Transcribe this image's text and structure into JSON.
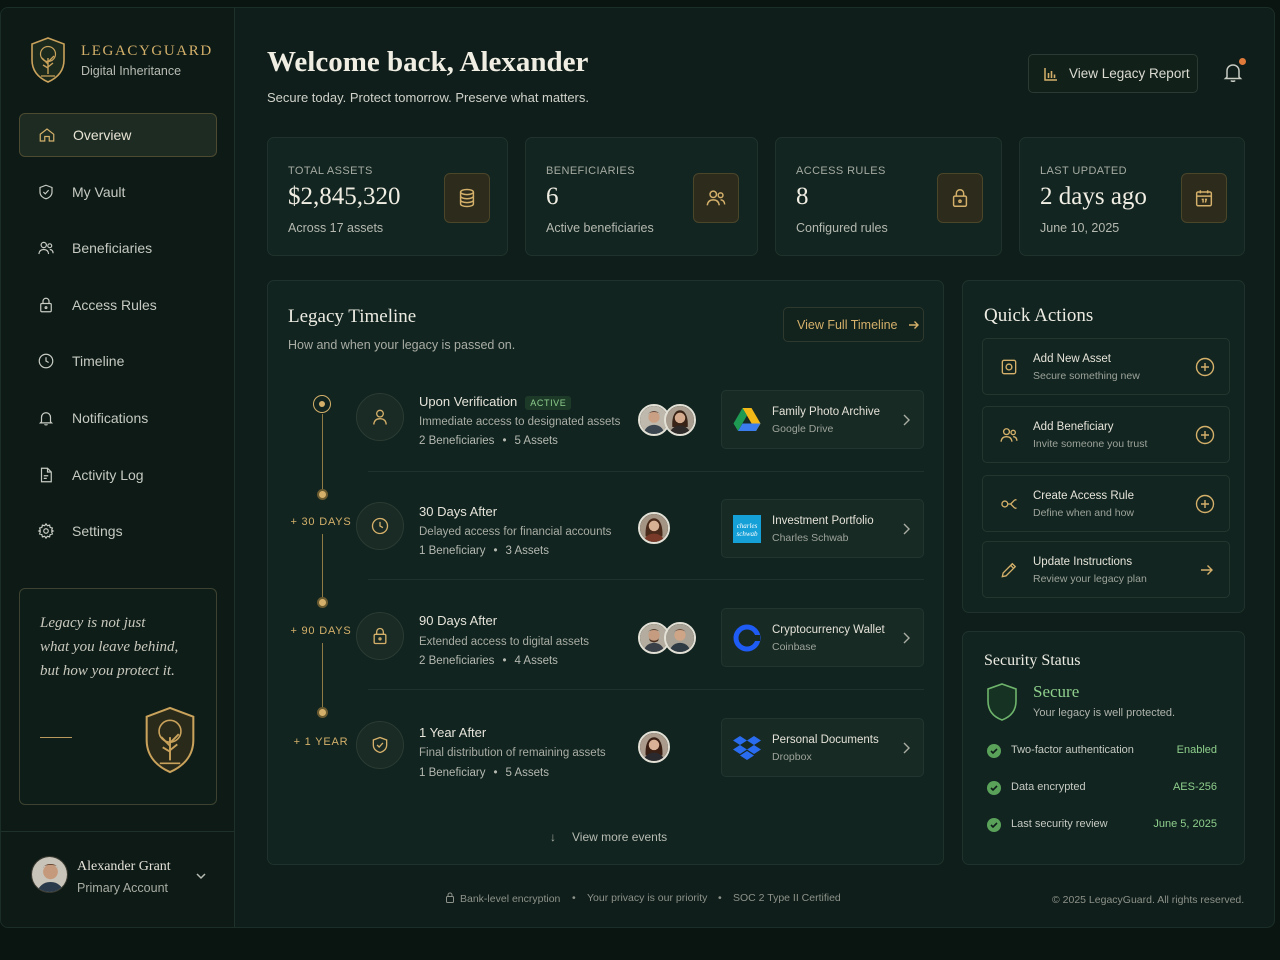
{
  "brand": {
    "name": "LEGACYGUARD",
    "tagline": "Digital Inheritance"
  },
  "nav": [
    {
      "label": "Overview",
      "icon": "home-icon",
      "active": true
    },
    {
      "label": "My Vault",
      "icon": "shield-icon"
    },
    {
      "label": "Beneficiaries",
      "icon": "users-icon"
    },
    {
      "label": "Access Rules",
      "icon": "lock-icon"
    },
    {
      "label": "Timeline",
      "icon": "clock-icon"
    },
    {
      "label": "Notifications",
      "icon": "bell-icon"
    },
    {
      "label": "Activity Log",
      "icon": "document-icon"
    },
    {
      "label": "Settings",
      "icon": "gear-icon"
    }
  ],
  "quote": {
    "line1": "Legacy is not just",
    "line2": "what you leave behind,",
    "line3": "but how you protect it."
  },
  "user": {
    "name": "Alexander Grant",
    "role": "Primary Account"
  },
  "header": {
    "welcome": "Welcome back, Alexander",
    "tagline": "Secure today. Protect tomorrow. Preserve what matters.",
    "report_button": "View Legacy Report"
  },
  "stats": [
    {
      "label": "TOTAL ASSETS",
      "value": "$2,845,320",
      "sub": "Across 17 assets",
      "icon": "database-icon"
    },
    {
      "label": "BENEFICIARIES",
      "value": "6",
      "sub": "Active beneficiaries",
      "icon": "users-icon"
    },
    {
      "label": "ACCESS RULES",
      "value": "8",
      "sub": "Configured rules",
      "icon": "lock-icon"
    },
    {
      "label": "LAST UPDATED",
      "value": "2 days ago",
      "sub": "June 10, 2025",
      "icon": "calendar-icon"
    }
  ],
  "timeline": {
    "title": "Legacy Timeline",
    "subtitle": "How and when your legacy is passed on.",
    "full_button": "View Full Timeline",
    "more": "View more events",
    "gaps": [
      "+ 30 DAYS",
      "+ 90 DAYS",
      "+ 1 YEAR"
    ],
    "events": [
      {
        "title": "Upon Verification",
        "badge": "ACTIVE",
        "desc": "Immediate access to designated assets",
        "beneficiaries": "2 Beneficiaries",
        "assets": "5 Assets",
        "asset_name": "Family Photo Archive",
        "asset_source": "Google Drive"
      },
      {
        "title": "30 Days After",
        "desc": "Delayed access for financial accounts",
        "beneficiaries": "1 Beneficiary",
        "assets": "3 Assets",
        "asset_name": "Investment Portfolio",
        "asset_source": "Charles Schwab"
      },
      {
        "title": "90 Days After",
        "desc": "Extended access to digital assets",
        "beneficiaries": "2 Beneficiaries",
        "assets": "4 Assets",
        "asset_name": "Cryptocurrency Wallet",
        "asset_source": "Coinbase"
      },
      {
        "title": "1 Year After",
        "desc": "Final distribution of remaining assets",
        "beneficiaries": "1 Beneficiary",
        "assets": "5 Assets",
        "asset_name": "Personal Documents",
        "asset_source": "Dropbox"
      }
    ]
  },
  "quick_actions": {
    "title": "Quick Actions",
    "items": [
      {
        "title": "Add New Asset",
        "sub": "Secure something new"
      },
      {
        "title": "Add Beneficiary",
        "sub": "Invite someone you trust"
      },
      {
        "title": "Create Access Rule",
        "sub": "Define when and how"
      },
      {
        "title": "Update Instructions",
        "sub": "Review your legacy plan"
      }
    ]
  },
  "security": {
    "title": "Security Status",
    "status": "Secure",
    "status_sub": "Your legacy is well protected.",
    "items": [
      {
        "label": "Two-factor authentication",
        "value": "Enabled"
      },
      {
        "label": "Data encrypted",
        "value": "AES-256"
      },
      {
        "label": "Last security review",
        "value": "June 5, 2025"
      }
    ]
  },
  "footer": {
    "encryption": "Bank-level encryption",
    "privacy": "Your privacy is our priority",
    "certified": "SOC 2 Type II Certified",
    "copyright": "© 2025 LegacyGuard. All rights reserved."
  },
  "logos": {
    "schwab": "charles schwab"
  },
  "colors": {
    "gold": "#d4b06a",
    "green": "#8fcf8c",
    "background": "#0f1e1a",
    "card": "#122520"
  }
}
